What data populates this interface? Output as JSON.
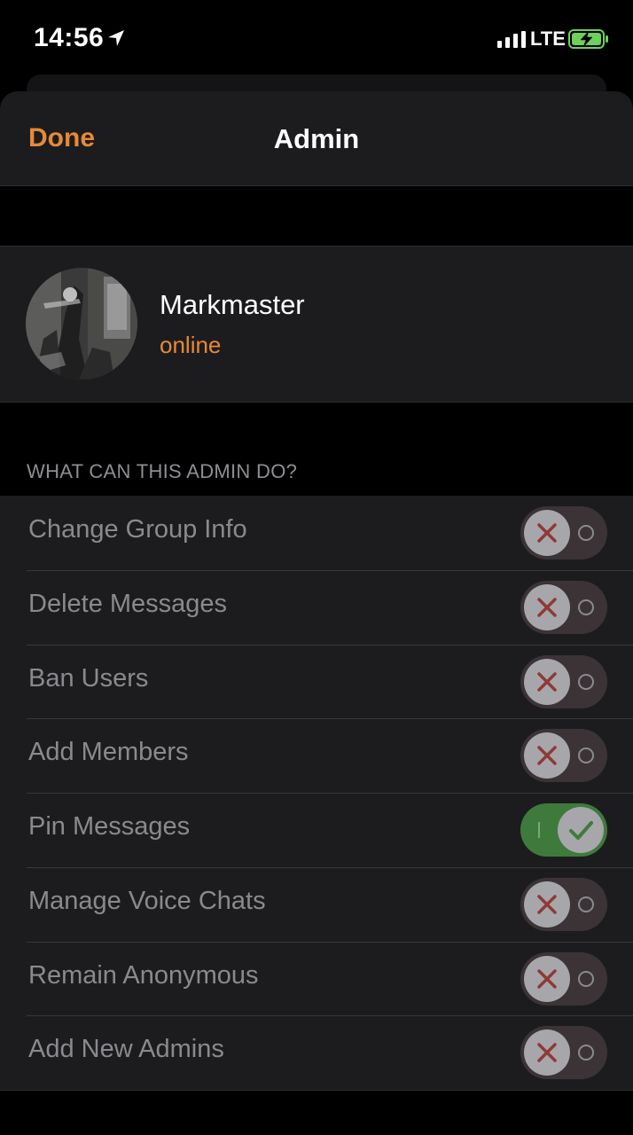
{
  "status_bar": {
    "time": "14:56",
    "network": "LTE"
  },
  "nav": {
    "done_label": "Done",
    "title": "Admin"
  },
  "profile": {
    "name": "Markmaster",
    "status": "online"
  },
  "section_header": "WHAT CAN THIS ADMIN DO?",
  "permissions": [
    {
      "label": "Change Group Info",
      "enabled": false
    },
    {
      "label": "Delete Messages",
      "enabled": false
    },
    {
      "label": "Ban Users",
      "enabled": false
    },
    {
      "label": "Add Members",
      "enabled": false
    },
    {
      "label": "Pin Messages",
      "enabled": true
    },
    {
      "label": "Manage Voice Chats",
      "enabled": false
    },
    {
      "label": "Remain Anonymous",
      "enabled": false
    },
    {
      "label": "Add New Admins",
      "enabled": false
    }
  ],
  "colors": {
    "accent": "#e5893a",
    "toggle_on": "#3f7a3d",
    "toggle_off": "#3b3336",
    "cross": "#8e3a36",
    "check": "#3f7a3d"
  }
}
